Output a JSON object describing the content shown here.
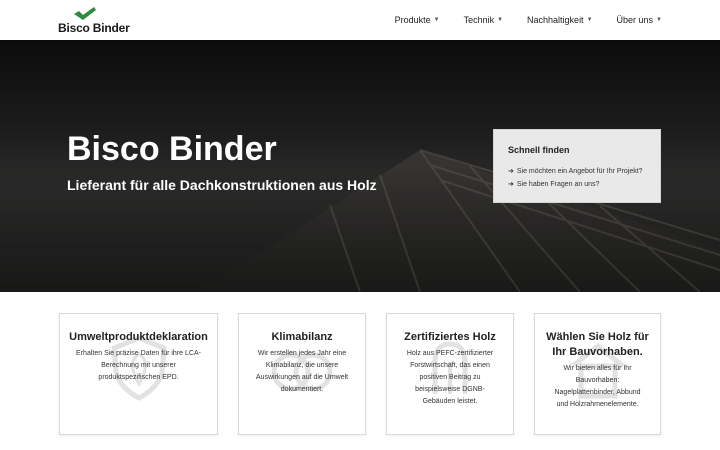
{
  "header": {
    "logo_text": "Bisco Binder",
    "brand_color": "#2e8b3d",
    "nav": [
      {
        "label": "Produkte"
      },
      {
        "label": "Technik"
      },
      {
        "label": "Nachhaltigkeit"
      },
      {
        "label": "Über uns"
      }
    ]
  },
  "hero": {
    "title": "Bisco Binder",
    "subtitle": "Lieferant für alle Dachkonstruktionen aus Holz"
  },
  "quick_find": {
    "title": "Schnell finden",
    "links": [
      {
        "label": "Sie möchten ein Angebot für Ihr Projekt?"
      },
      {
        "label": "Sie haben Fragen an uns?"
      }
    ]
  },
  "cards": [
    {
      "title": "Umweltproduktdeklaration",
      "text": "Erhalten Sie präzise Daten für ihre LCA-Berechnung mit unserer produktspezifischen EPD.",
      "icon": "shield-leaf-icon"
    },
    {
      "title": "Klimabilanz",
      "text": "Wir erstellen jedes Jahr eine Klimabilanz, die unsere Auswirkungen auf die Umwelt dokumentiert.",
      "icon": "leaves-icon"
    },
    {
      "title": "Zertifiziertes Holz",
      "text": "Holz aus PEFC-zertifizierter Forstwirtschaft, das einen positiven Beitrag zu beispielsweise DGNB-Gebäuden leistet.",
      "icon": "tree-certificate-icon"
    },
    {
      "title": "Wählen Sie Holz für Ihr Bauvorhaben.",
      "text": "Wir bieten alles für Ihr Bauvorhaben: Nagelplattenbinder, Abbund und Holzrahmenelemente.",
      "icon": "house-frame-icon"
    }
  ]
}
